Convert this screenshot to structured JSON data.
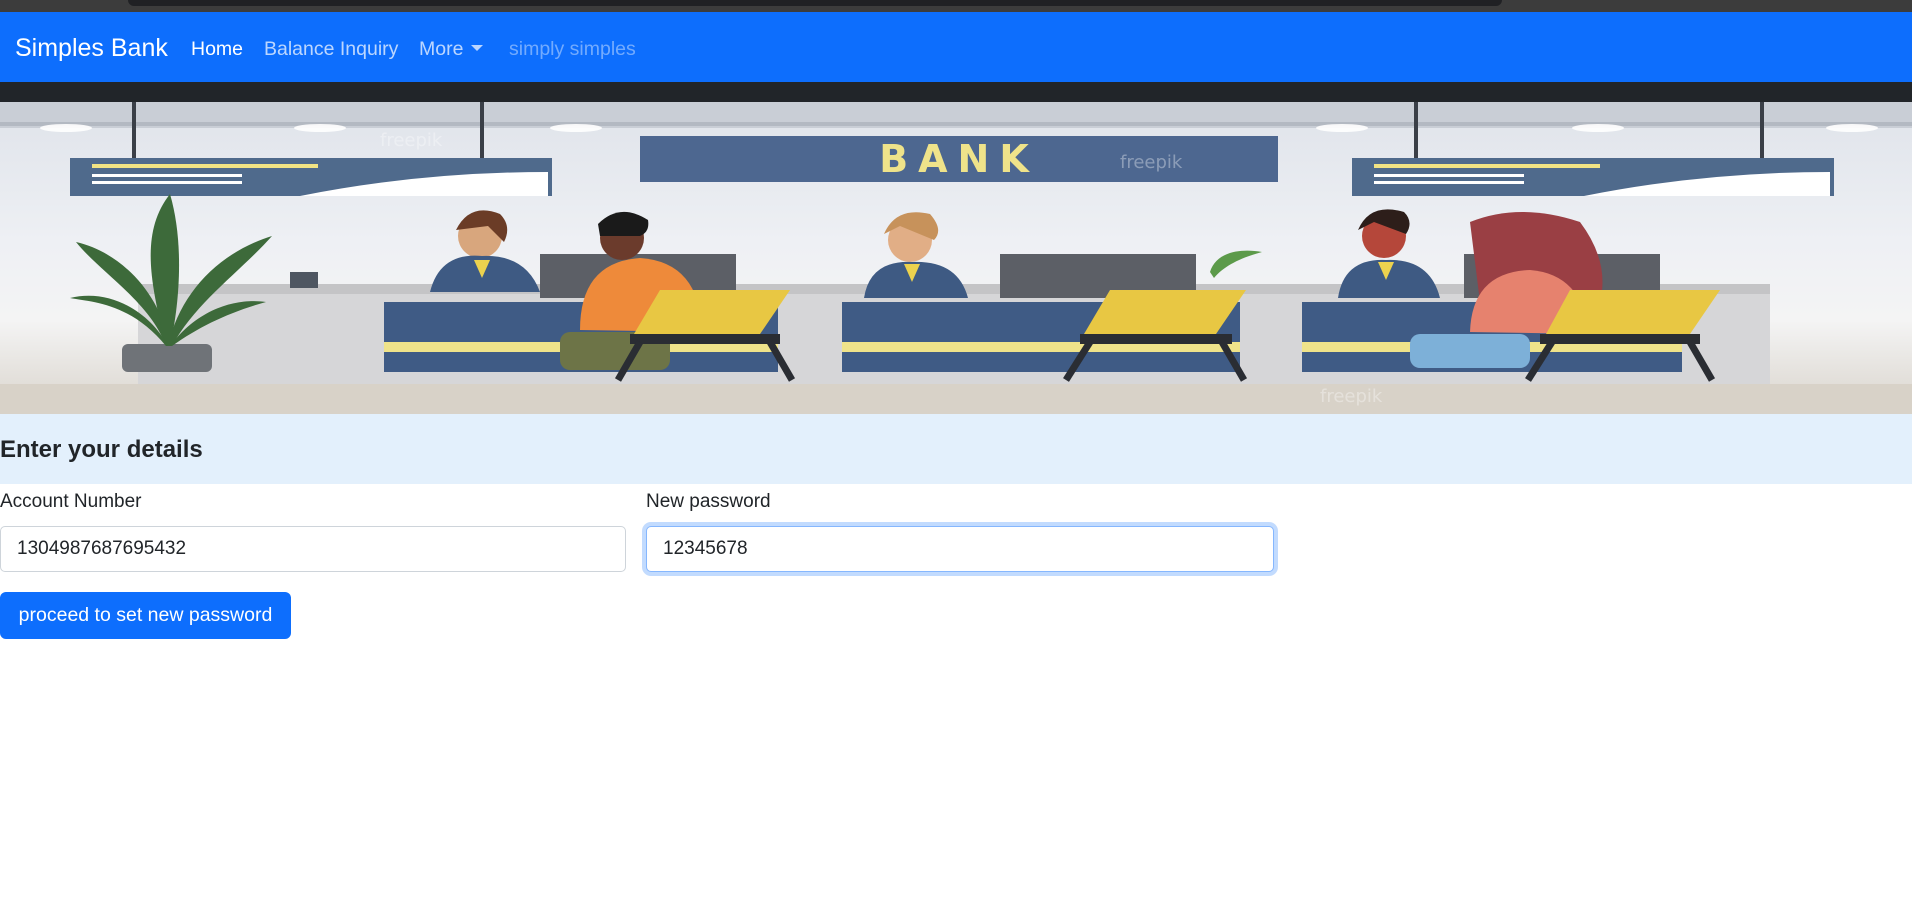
{
  "navbar": {
    "brand": "Simples Bank",
    "links": [
      {
        "label": "Home",
        "state": "active"
      },
      {
        "label": "Balance Inquiry",
        "state": "normal"
      },
      {
        "label": "More",
        "state": "dropdown"
      },
      {
        "label": "simply simples",
        "state": "disabled"
      }
    ]
  },
  "banner": {
    "sign_text": "BANK",
    "watermark": "freepik"
  },
  "form": {
    "title": "Enter your details",
    "account_label": "Account Number",
    "account_value": "1304987687695432",
    "password_label": "New password",
    "password_value": "12345678",
    "submit_label": "proceed to set new password"
  },
  "colors": {
    "primary": "#0d6efd",
    "form_header_bg": "#e3f0fc",
    "dark_band": "#212529"
  }
}
